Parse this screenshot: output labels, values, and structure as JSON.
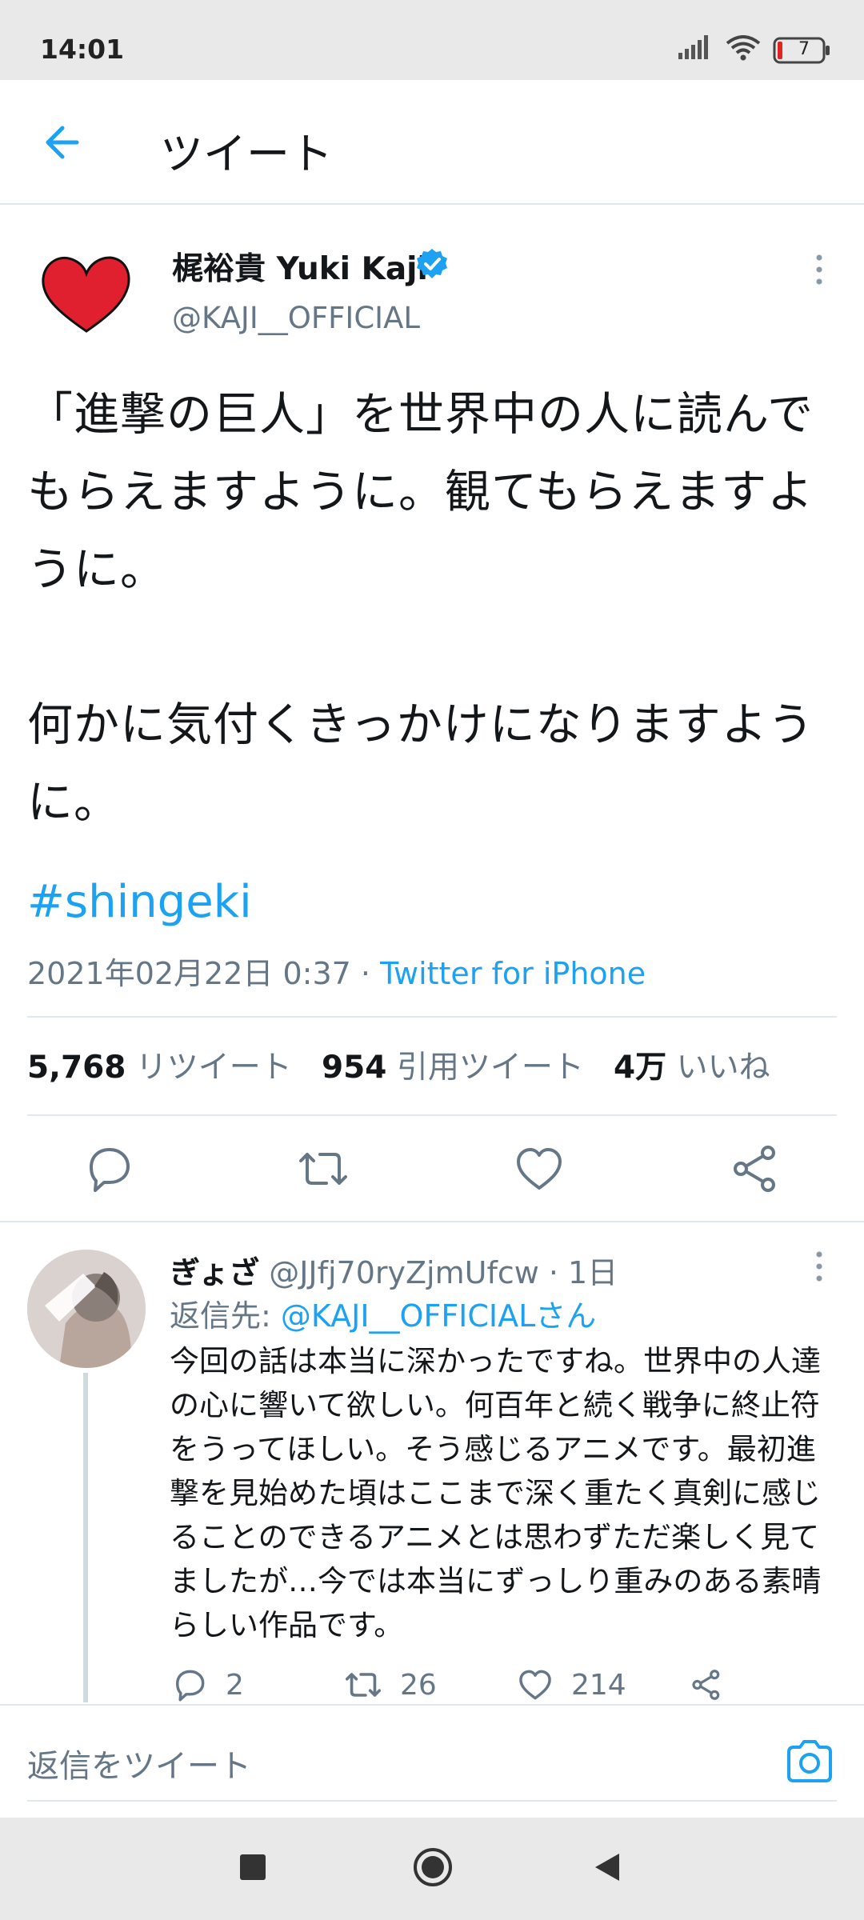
{
  "status_bar": {
    "time": "14:01",
    "battery_level": "7",
    "icons": [
      "signal-icon",
      "wifi-icon",
      "battery-icon"
    ]
  },
  "header": {
    "title": "ツイート",
    "back_icon": "arrow-left-icon"
  },
  "tweet": {
    "author_name": "梶裕貴 Yuki Kaji",
    "author_handle": "@KAJI__OFFICIAL",
    "verified": true,
    "text": "「進撃の巨人」を世界中の人に読んでもらえますように。観てもらえますように。\n\n何かに気付くきっかけになりますように。",
    "hashtag": "#shingeki",
    "timestamp": "2021年02月22日 0:37",
    "separator": " · ",
    "source": "Twitter for iPhone",
    "stats": {
      "retweets_count": "5,768",
      "retweets_label": "リツイート",
      "quotes_count": "954",
      "quotes_label": "引用ツイート",
      "likes_count": "4万",
      "likes_label": "いいね"
    },
    "actions": [
      "reply-icon",
      "retweet-icon",
      "like-icon",
      "share-icon"
    ]
  },
  "reply": {
    "name": "ぎょざ",
    "handle": "@JJfj70ryZjmUfcw",
    "age": " · 1日",
    "replying_prefix": "返信先: ",
    "replying_handle": "@KAJI__OFFICIALさん",
    "text": "今回の話は本当に深かったですね。世界中の人達の心に響いて欲しい。何百年と続く戦争に終止符をうってほしい。そう感じるアニメです。最初進撃を見始めた頃はここまで深く重たく真剣に感じることのできるアニメとは思わずただ楽しく見てましたが…今では本当にずっしり重みのある素晴らしい作品です。",
    "reply_count": "2",
    "retweet_count": "26",
    "like_count": "214"
  },
  "compose": {
    "placeholder": "返信をツイート",
    "camera_icon": "camera-icon"
  },
  "colors": {
    "accent": "#1da1f2",
    "secondary_text": "#657786",
    "divider": "#e1e8ed",
    "system_bar": "#e9e9e9"
  }
}
